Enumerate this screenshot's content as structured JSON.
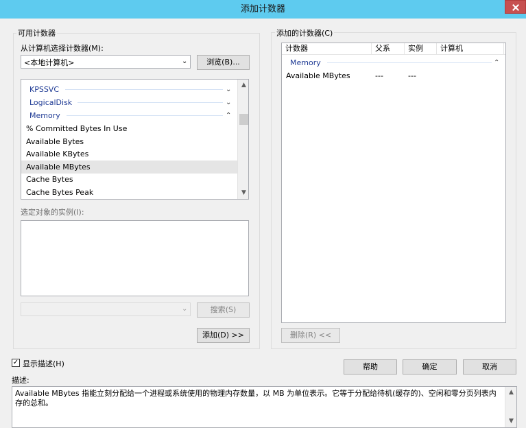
{
  "window": {
    "title": "添加计数器"
  },
  "available": {
    "group_label": "可用计数器",
    "select_computer_label": "从计算机选择计数器(M):",
    "computer_value": "<本地计算机>",
    "browse_label": "浏览(B)...",
    "counters": [
      {
        "label": "KPSSVC",
        "category": true,
        "expanded": false
      },
      {
        "label": "LogicalDisk",
        "category": true,
        "expanded": false
      },
      {
        "label": "Memory",
        "category": true,
        "expanded": true
      },
      {
        "label": "% Committed Bytes In Use"
      },
      {
        "label": "Available Bytes"
      },
      {
        "label": "Available KBytes"
      },
      {
        "label": "Available MBytes",
        "selected": true
      },
      {
        "label": "Cache Bytes"
      },
      {
        "label": "Cache Bytes Peak"
      }
    ],
    "instances_label": "选定对象的实例(I):",
    "search_label": "搜索(S)",
    "add_label": "添加(D) >>"
  },
  "added": {
    "group_label": "添加的计数器(C)",
    "columns": [
      "计数器",
      "父系",
      "实例",
      "计算机"
    ],
    "category": "Memory",
    "rows": [
      {
        "counter": "Available MBytes",
        "parent": "---",
        "instance": "---",
        "computer": ""
      }
    ],
    "remove_label": "删除(R) <<"
  },
  "footer": {
    "show_desc_label": "显示描述(H)",
    "show_desc_checked": true,
    "help_label": "帮助",
    "ok_label": "确定",
    "cancel_label": "取消",
    "desc_label": "描述:",
    "description": "Available MBytes 指能立刻分配给一个进程或系统使用的物理内存数量，以 MB 为单位表示。它等于分配给待机(缓存的)、空闲和零分页列表内存的总和。"
  },
  "colors": {
    "titlebar": "#5ecbef",
    "close": "#c75050",
    "category_text": "#1e3a94"
  }
}
